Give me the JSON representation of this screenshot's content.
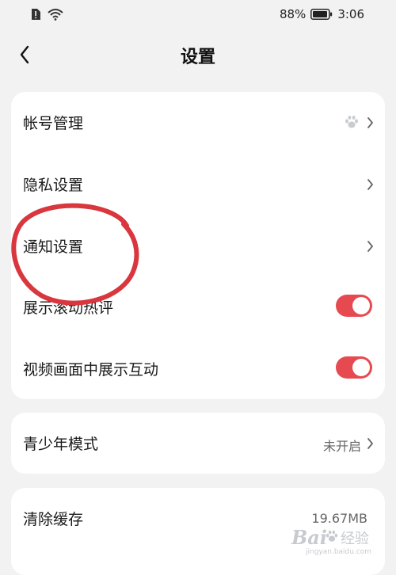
{
  "status_bar": {
    "battery_percent": "88%",
    "time": "3:06",
    "icons": [
      "sim-alert-icon",
      "wifi-icon",
      "battery-icon"
    ]
  },
  "header": {
    "title": "设置",
    "back_icon": "chevron-left-icon"
  },
  "settings_group_1": [
    {
      "label": "帐号管理",
      "type": "link",
      "icon": "paw-icon"
    },
    {
      "label": "隐私设置",
      "type": "link"
    },
    {
      "label": "通知设置",
      "type": "link"
    },
    {
      "label": "展示滚动热评",
      "type": "toggle",
      "enabled": true
    },
    {
      "label": "视频画面中展示互动",
      "type": "toggle",
      "enabled": true
    }
  ],
  "settings_group_2": [
    {
      "label": "青少年模式",
      "type": "link",
      "value": "未开启"
    }
  ],
  "settings_group_3": [
    {
      "label": "清除缓存",
      "type": "value",
      "value": "19.67MB"
    }
  ],
  "colors": {
    "toggle_on": "#e64a50",
    "annotation": "#d9363e",
    "background": "#f2f2f2",
    "card": "#ffffff"
  },
  "watermark": {
    "brand": "Bai",
    "sub": "经验",
    "url": "jingyan.baidu.com"
  }
}
